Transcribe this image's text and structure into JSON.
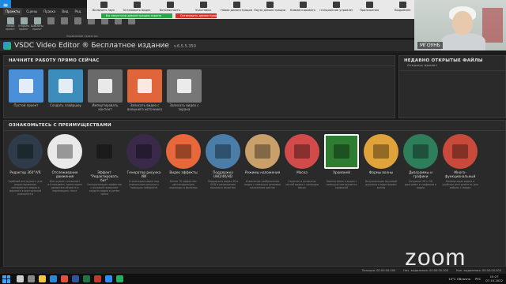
{
  "zoom_bar": {
    "items": [
      {
        "label": "Включить звук"
      },
      {
        "label": "Остановить видео"
      },
      {
        "label": "Безопасность"
      },
      {
        "label": "Участники"
      },
      {
        "label": "Новая демонстрация"
      },
      {
        "label": "Пауза демонстрации"
      },
      {
        "label": "Комментировать"
      },
      {
        "label": "Дистанционное управление"
      },
      {
        "label": "Приложения"
      },
      {
        "label": "Подробнее"
      }
    ],
    "sharing_notice": "Вы запустили демонстрацию экрана",
    "stop_button": "Остановить демонстрацию"
  },
  "ribbon": {
    "tabs": [
      "Проекты",
      "Сцены",
      "Правка",
      "Вид",
      "Ред."
    ],
    "active_tab": 0,
    "buttons": [
      {
        "label": "Новый проект",
        "color": "#9aa"
      },
      {
        "label": "Открыть проект",
        "color": "#9aa"
      },
      {
        "label": "Шаблоны проект",
        "color": "#9aa"
      },
      {
        "label": "",
        "color": "#777"
      },
      {
        "label": "",
        "color": "#777"
      },
      {
        "label": "",
        "color": "#777"
      },
      {
        "label": "",
        "color": "#777"
      },
      {
        "label": "",
        "color": "#777"
      },
      {
        "label": "",
        "color": "#777"
      },
      {
        "label": "",
        "color": "#777"
      }
    ],
    "group_label": "Управление проектом"
  },
  "title_bar": {
    "title": "VSDC Video Editor ® Бесплатное издание",
    "version": "v.6.5.5.350"
  },
  "webcam": {
    "participant_name": "МГОУНБ"
  },
  "start_panel": {
    "heading": "НАЧНИТЕ РАБОТУ ПРЯМО СЕЙЧАС",
    "tiles": [
      {
        "label": "Пустой проект",
        "color": "#4a90d9"
      },
      {
        "label": "Создать слайдшоу",
        "color": "#3c8dbc"
      },
      {
        "label": "Импортировать контент",
        "color": "#6a6a6a"
      },
      {
        "label": "Записать видео с внешнего источника",
        "color": "#e0653a"
      },
      {
        "label": "Записать видео с экрана",
        "color": "#777"
      }
    ]
  },
  "recent_panel": {
    "heading": "НЕДАВНО ОТКРЫТЫЕ ФАЙЛЫ",
    "hint": "Открыть проект"
  },
  "features_panel": {
    "heading": "ОЗНАКОМЬТЕСЬ С ПРЕИМУЩЕСТВАМИ",
    "features": [
      {
        "name": "Редактор 360°/VR",
        "desc": "Удобный инструмент для редактирования панорамного видео в формате в виртуальной реальности",
        "color": "#2f3b48"
      },
      {
        "name": "Отслеживание движения",
        "desc": "Инструмент позволяет отслеживать траекторию движения объекта и перемещать текст",
        "color": "#e9e9e9"
      },
      {
        "name": "Эффект \"Редактировать бит\"",
        "desc": "Синхронизация эффектов с музыкой позволяет создать видео в ритме трека",
        "color": "#2a2a2a"
      },
      {
        "name": "Генератор рисунка ИИ",
        "desc": "Стилизация видео под уникальные рисунки с помощью нейросети",
        "color": "#3a2a4a"
      },
      {
        "name": "Видео эффекты",
        "desc": "Более 70 эффектов: цветокоррекция, переходы и фильтры",
        "color": "#e8673b"
      },
      {
        "name": "Поддержка UHD/4K/HD",
        "desc": "Поддержка видео 4K и UHD и разрешения высокого качества",
        "color": "#4a7da8"
      },
      {
        "name": "Режимы наложения",
        "desc": "Изменение изображения видео с помощью режимов наложения цветов",
        "color": "#c9a06a"
      },
      {
        "name": "Маска",
        "desc": "Скрытие и размытие частей видео с помощью масок",
        "color": "#d14b4b"
      },
      {
        "name": "Хромакей",
        "desc": "Замена фона в видео с помощью инструмента хромакей",
        "color": "#2e7d32",
        "selected": true
      },
      {
        "name": "Формы волны",
        "desc": "Визуализация звуковой дорожки в виде формы волны",
        "color": "#e0a23a"
      },
      {
        "name": "Диаграммы и графики",
        "desc": "Создание 2D и 3D диаграмм и графиков в видео",
        "color": "#2e7d5b"
      },
      {
        "name": "Много-функциональный",
        "desc": "Конвертация видео и удобные инструменты для работы с медиа",
        "color": "#c94a3a"
      }
    ]
  },
  "status_bar": {
    "position": "Позиция: 00:00:00.000",
    "start": "Нач. выделения: 00:00:00.000",
    "end": "Кон. выделения: 00:00:00.000"
  },
  "zoom_logo": "zoom",
  "taskbar": {
    "weather": "10°C Облачно",
    "lang": "РУС",
    "time": "15:27",
    "date": "07.10.2022",
    "icons": [
      {
        "name": "search-icon",
        "color": "#cccccc"
      },
      {
        "name": "task-view-icon",
        "color": "#888888"
      },
      {
        "name": "explorer-icon",
        "color": "#f5c542"
      },
      {
        "name": "edge-icon",
        "color": "#2b88d8"
      },
      {
        "name": "chrome-icon",
        "color": "#e74c3c"
      },
      {
        "name": "word-icon",
        "color": "#2b579a"
      },
      {
        "name": "excel-icon",
        "color": "#217346"
      },
      {
        "name": "acrobat-icon",
        "color": "#c0392b"
      },
      {
        "name": "zoom-icon",
        "color": "#2d8cff"
      },
      {
        "name": "vsdc-icon",
        "color": "#27ae60"
      }
    ]
  }
}
